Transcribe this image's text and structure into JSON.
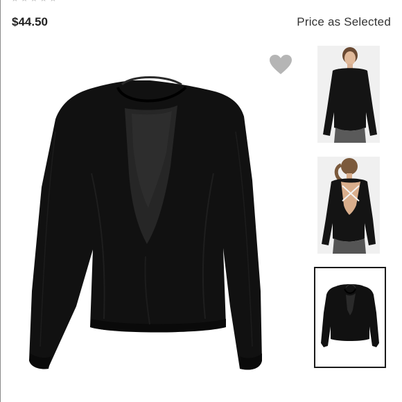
{
  "product": {
    "rating_stars": "★★★★★",
    "price": "$44.50",
    "price_note": "Price as Selected"
  },
  "favorite": {
    "icon": "heart-icon",
    "color": "#b5b5b5"
  },
  "colors": {
    "garment": "#111111",
    "thumb_background": "#f0f0f0",
    "selected_border": "#1a1a1a"
  },
  "thumbnails": [
    {
      "view": "front-model",
      "selected": false
    },
    {
      "view": "back-model",
      "selected": false
    },
    {
      "view": "flat-back",
      "selected": true
    }
  ]
}
